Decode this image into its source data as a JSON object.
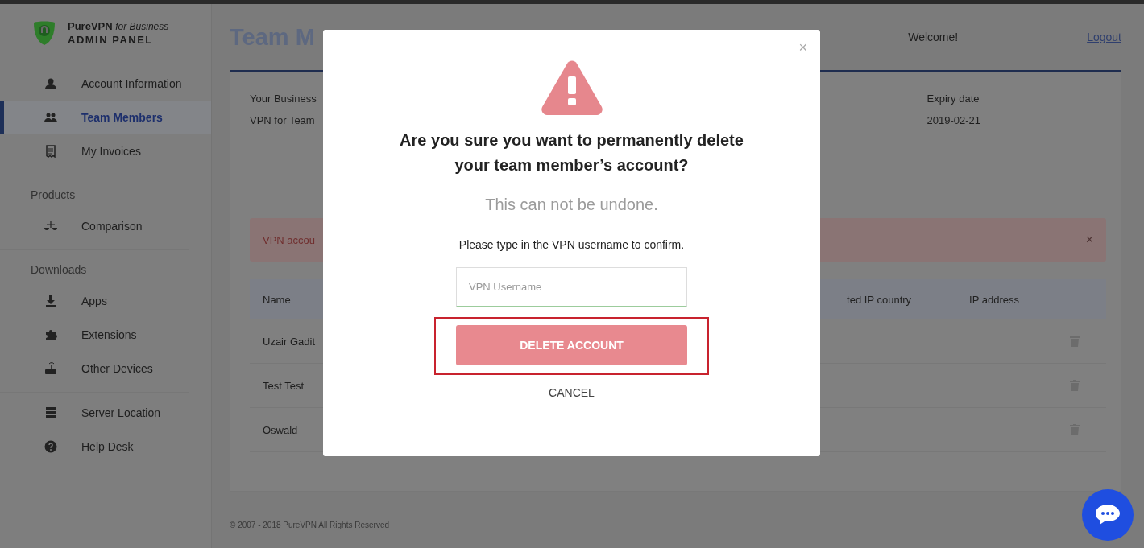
{
  "brand": {
    "name": "PureVPN",
    "tagline": "for Business",
    "subtitle": "ADMIN PANEL"
  },
  "sidebar": {
    "groups": [
      {
        "items": [
          {
            "label": "Account Information",
            "selected": false
          },
          {
            "label": "Team Members",
            "selected": true
          },
          {
            "label": "My Invoices",
            "selected": false
          }
        ]
      },
      {
        "heading": "Products",
        "items": [
          {
            "label": "Comparison",
            "selected": false
          }
        ]
      },
      {
        "heading": "Downloads",
        "items": [
          {
            "label": "Apps",
            "selected": false
          },
          {
            "label": "Extensions",
            "selected": false
          },
          {
            "label": "Other Devices",
            "selected": false
          }
        ]
      },
      {
        "items": [
          {
            "label": "Server Location",
            "selected": false
          },
          {
            "label": "Help Desk",
            "selected": false
          }
        ]
      }
    ]
  },
  "header": {
    "title": "Team M",
    "welcome": "Welcome!",
    "logout": "Logout"
  },
  "summary": [
    {
      "label": "Your Business",
      "value": "VPN for Team"
    },
    {
      "label": "Expiry date",
      "value": "2019-02-21"
    }
  ],
  "alert": {
    "text": "VPN accou",
    "close": "×"
  },
  "table": {
    "columns": [
      "Name",
      "ted IP country",
      "IP address"
    ],
    "rows": [
      {
        "name": "Uzair Gadit"
      },
      {
        "name": "Test Test"
      },
      {
        "name": "Oswald"
      }
    ]
  },
  "modal": {
    "close": "×",
    "title": "Are you sure you want to permanently delete your team member’s account?",
    "note": "This can not be undone.",
    "instruction": "Please type in the VPN username to confirm.",
    "input": {
      "placeholder": "VPN Username"
    },
    "confirm": "DELETE ACCOUNT",
    "confirm_highlighted": true,
    "cancel": "CANCEL"
  },
  "footer": "© 2007 - 2018 PureVPN All Rights Reserved"
}
